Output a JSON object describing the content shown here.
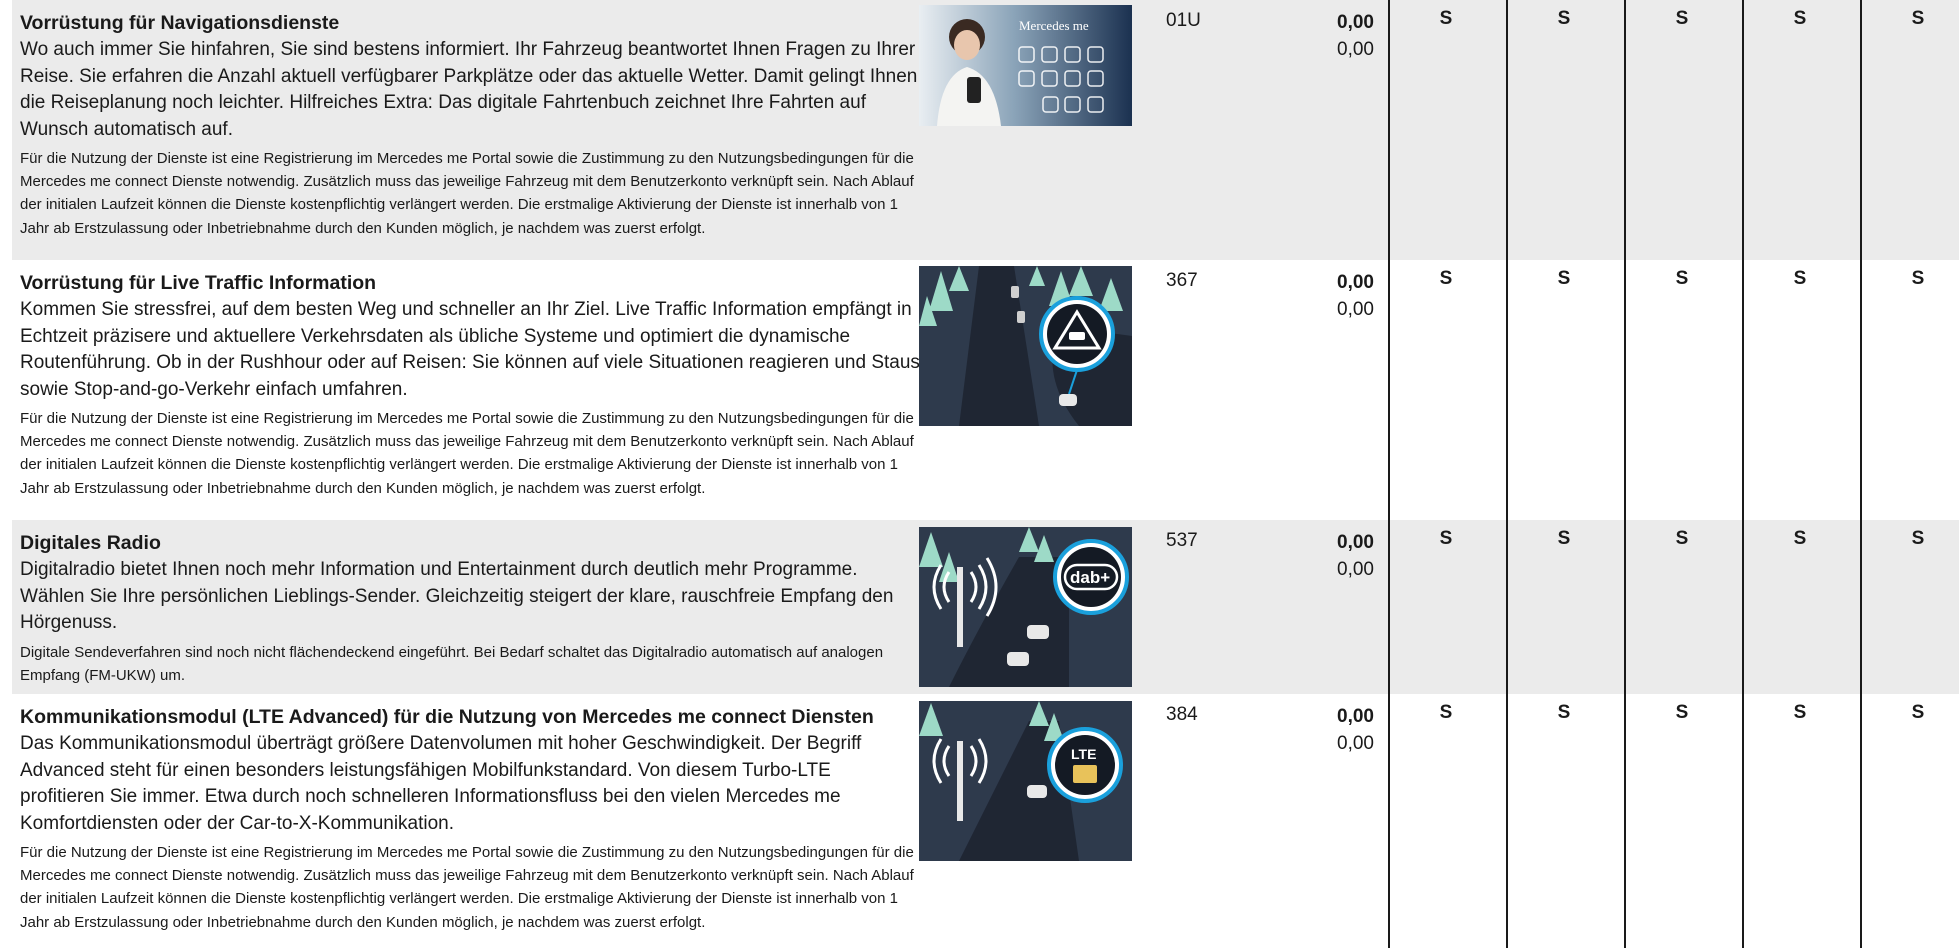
{
  "rows": [
    {
      "title": "Vorrüstung für Navigationsdienste",
      "body": "Wo auch immer Sie hinfahren, Sie sind bestens informiert. Ihr Fahrzeug beantwortet Ihnen Fragen zu Ihrer Reise. Sie erfahren die Anzahl aktuell verfügbarer Parkplätze oder das aktuelle Wetter. Damit gelingt Ihnen die Reiseplanung noch leichter. Hilfreiches Extra: Das digitale Fahrtenbuch zeichnet Ihre Fahrten auf Wunsch automatisch auf.",
      "note": "Für die Nutzung der Dienste ist eine Registrierung im Mercedes me Portal sowie die Zustimmung zu den Nutzungs­bedingungen für die Mercedes me connect Dienste notwendig. Zusätzlich muss das jeweilige Fahrzeug mit dem Benutzerkonto verknüpft sein. Nach Ablauf der initialen Laufzeit können die Dienste kostenpflichtig verlängert werden. Die erstmalige Aktivierung der Dienste ist innerhalb von 1 Jahr ab Erstzulassung oder Inbetriebnahme durch den Kunden möglich, je nachdem was zuerst erfolgt.",
      "image_label": "Mercedes me",
      "code": "01U",
      "price_net": "0,00",
      "price_gross": "0,00",
      "standard": [
        "S",
        "S",
        "S",
        "S",
        "S"
      ]
    },
    {
      "title": "Vorrüstung für Live Traffic Information",
      "body": "Kommen Sie stressfrei, auf dem besten Weg und schneller an Ihr Ziel. Live Traffic Information empfängt in Echtzeit präzisere und aktuellere Verkehrsdaten als übliche Systeme und optimiert die dynamische Routenführung. Ob in der Rushhour oder auf Reisen: Sie können auf viele Situationen reagieren und Staus sowie Stop-and-go-Verkehr einfach umfahren.",
      "note": "Für die Nutzung der Dienste ist eine Registrierung im Mercedes me Portal sowie die Zustimmung zu den Nutzungs­bedingungen für die Mercedes me connect Dienste notwendig. Zusätzlich muss das jeweilige Fahrzeug mit dem Benutzerkonto verknüpft sein. Nach Ablauf der initialen Laufzeit können die Dienste kostenpflichtig verlängert werden. Die erstmalige Aktivierung der Dienste ist innerhalb von 1 Jahr ab Erstzulassung oder Inbetriebnahme durch den Kunden möglich, je nachdem was zuerst erfolgt.",
      "image_label": "",
      "code": "367",
      "price_net": "0,00",
      "price_gross": "0,00",
      "standard": [
        "S",
        "S",
        "S",
        "S",
        "S"
      ]
    },
    {
      "title": "Digitales Radio",
      "body": "Digitalradio bietet Ihnen noch mehr Information und Entertainment durch deutlich mehr Programme. Wählen Sie Ihre persönlichen Lieblings-Sender. Gleichzeitig steigert der klare, rauschfreie Empfang den Hörgenuss.",
      "note": "Digitale Sendeverfahren sind noch nicht flächendeckend eingeführt. Bei Bedarf schaltet das Digitalradio automatisch auf analogen Empfang (FM-UKW) um.",
      "image_label": "dab+",
      "code": "537",
      "price_net": "0,00",
      "price_gross": "0,00",
      "standard": [
        "S",
        "S",
        "S",
        "S",
        "S"
      ]
    },
    {
      "title": "Kommunikationsmodul (LTE Advanced) für die Nutzung von Mercedes me connect Diensten",
      "body": "Das Kommunikationsmodul überträgt größere Datenvolumen mit hoher Geschwindigkeit. Der Begriff Advanced steht für einen besonders leistungsfähigen Mobilfunkstandard. Von diesem Turbo-LTE profitieren Sie immer. Etwa durch noch schnelleren Informationsfluss bei den vielen Mercedes me Komfortdiensten oder der Car-to-X-Kommunikation.",
      "note": "Für die Nutzung der Dienste ist eine Registrierung im Mercedes me Portal sowie die Zustimmung zu den Nutzungs­bedingungen für die Mercedes me connect Dienste notwendig. Zusätzlich muss das jeweilige Fahrzeug mit dem Benutzerkonto verknüpft sein. Nach Ablauf der initialen Laufzeit können die Dienste kostenpflichtig verlängert werden. Die erstmalige Aktivierung der Dienste ist innerhalb von 1 Jahr ab Erstzulassung oder Inbetriebnahme durch den Kunden möglich, je nachdem was zuerst erfolgt.",
      "image_label": "LTE",
      "code": "384",
      "price_net": "0,00",
      "price_gross": "0,00",
      "standard": [
        "S",
        "S",
        "S",
        "S",
        "S"
      ]
    }
  ],
  "colors": {
    "row_shade": "#ebebeb",
    "text": "#1a1a1a",
    "accent_blue": "#1aa0dc",
    "road_dark": "#2b3748",
    "tree_mint": "#8fd6c0"
  }
}
